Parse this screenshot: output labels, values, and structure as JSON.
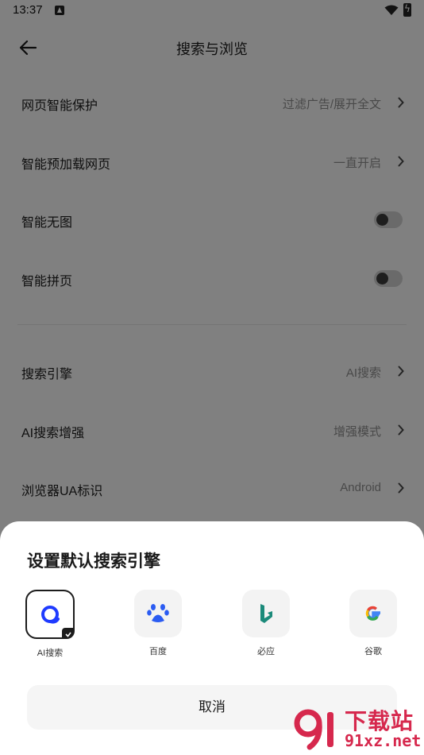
{
  "status_bar": {
    "time": "13:37"
  },
  "header": {
    "title": "搜索与浏览"
  },
  "settings": [
    {
      "label": "网页智能保护",
      "value": "过滤广告/展开全文",
      "control": "chevron",
      "toggle_on": null
    },
    {
      "label": "智能预加载网页",
      "value": "一直开启",
      "control": "chevron",
      "toggle_on": null
    },
    {
      "label": "智能无图",
      "value": "",
      "control": "toggle",
      "toggle_on": false
    },
    {
      "label": "智能拼页",
      "value": "",
      "control": "toggle",
      "toggle_on": false
    },
    {
      "label": "搜索引擎",
      "value": "AI搜索",
      "control": "chevron",
      "toggle_on": null
    },
    {
      "label": "AI搜索增强",
      "value": "增强模式",
      "control": "chevron",
      "toggle_on": null
    },
    {
      "label": "浏览器UA标识",
      "value": "Android",
      "control": "chevron",
      "toggle_on": null
    }
  ],
  "sheet": {
    "title": "设置默认搜索引擎",
    "engines": [
      {
        "label": "AI搜索",
        "icon": "ai-search-icon",
        "selected": true
      },
      {
        "label": "百度",
        "icon": "baidu-paw-icon",
        "selected": false
      },
      {
        "label": "必应",
        "icon": "bing-icon",
        "selected": false
      },
      {
        "label": "谷歌",
        "icon": "google-g-icon",
        "selected": false
      }
    ],
    "cancel_label": "取消"
  },
  "watermark": {
    "top": "下载站",
    "bottom": "91xz.net"
  },
  "colors": {
    "accent": "#1f3bff",
    "baidu": "#2b5cf2",
    "bing": "#1b8a7a",
    "watermark": "#d6284d"
  }
}
